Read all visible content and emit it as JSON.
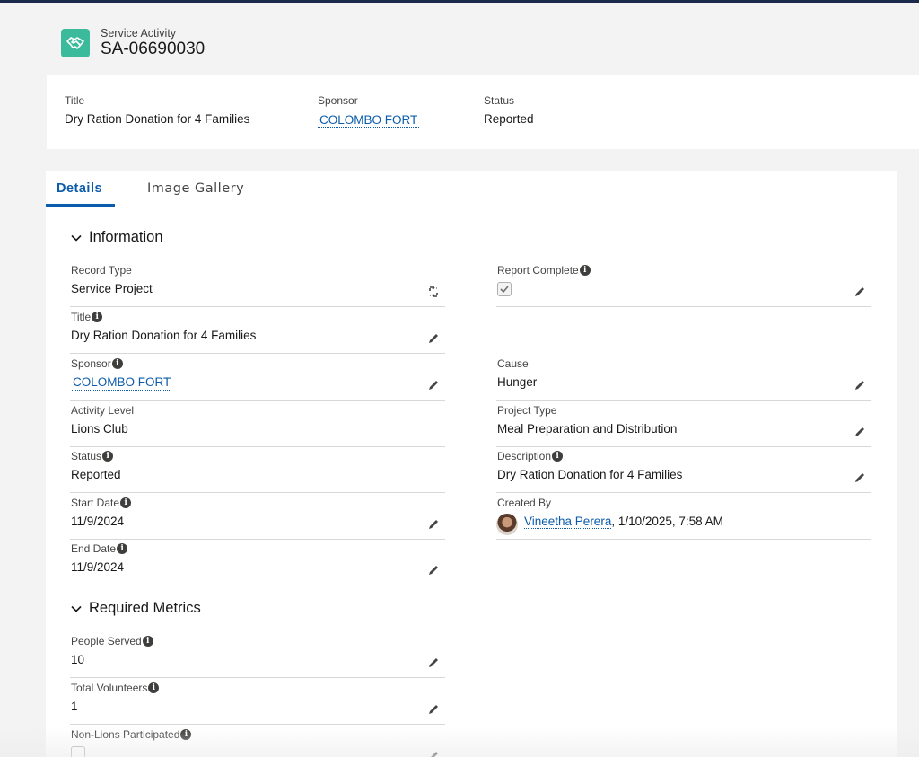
{
  "record": {
    "object_type": "Service Activity",
    "name": "SA-06690030",
    "icon": "handshake-icon",
    "accent": "#3bba9c"
  },
  "highlights": {
    "title_label": "Title",
    "title_value": "Dry Ration Donation for 4 Families",
    "sponsor_label": "Sponsor",
    "sponsor_value": "COLOMBO FORT",
    "status_label": "Status",
    "status_value": "Reported"
  },
  "tabs": [
    {
      "label": "Details",
      "active": true
    },
    {
      "label": "Image Gallery",
      "active": false
    }
  ],
  "sections": {
    "information": "Information",
    "required_metrics": "Required Metrics"
  },
  "fields": {
    "record_type": {
      "label": "Record Type",
      "value": "Service Project"
    },
    "title": {
      "label": "Title",
      "value": "Dry Ration Donation for 4 Families"
    },
    "sponsor": {
      "label": "Sponsor",
      "value": "COLOMBO FORT"
    },
    "activity_level": {
      "label": "Activity Level",
      "value": "Lions Club"
    },
    "status": {
      "label": "Status",
      "value": "Reported"
    },
    "start_date": {
      "label": "Start Date",
      "value": "11/9/2024"
    },
    "end_date": {
      "label": "End Date",
      "value": "11/9/2024"
    },
    "report_complete": {
      "label": "Report Complete",
      "checked": true
    },
    "cause": {
      "label": "Cause",
      "value": "Hunger"
    },
    "project_type": {
      "label": "Project Type",
      "value": "Meal Preparation and Distribution"
    },
    "description": {
      "label": "Description",
      "value": "Dry Ration Donation for 4 Families"
    },
    "created_by": {
      "label": "Created By",
      "user": "Vineetha Perera",
      "timestamp": ", 1/10/2025, 7:58 AM"
    },
    "people_served": {
      "label": "People Served",
      "value": "10"
    },
    "total_volunteers": {
      "label": "Total Volunteers",
      "value": "1"
    },
    "non_lions": {
      "label": "Non-Lions Participated",
      "checked": false
    }
  },
  "colors": {
    "link": "#0b5cab",
    "background": "#f3f3f3",
    "divider": "#d8d8d8"
  }
}
